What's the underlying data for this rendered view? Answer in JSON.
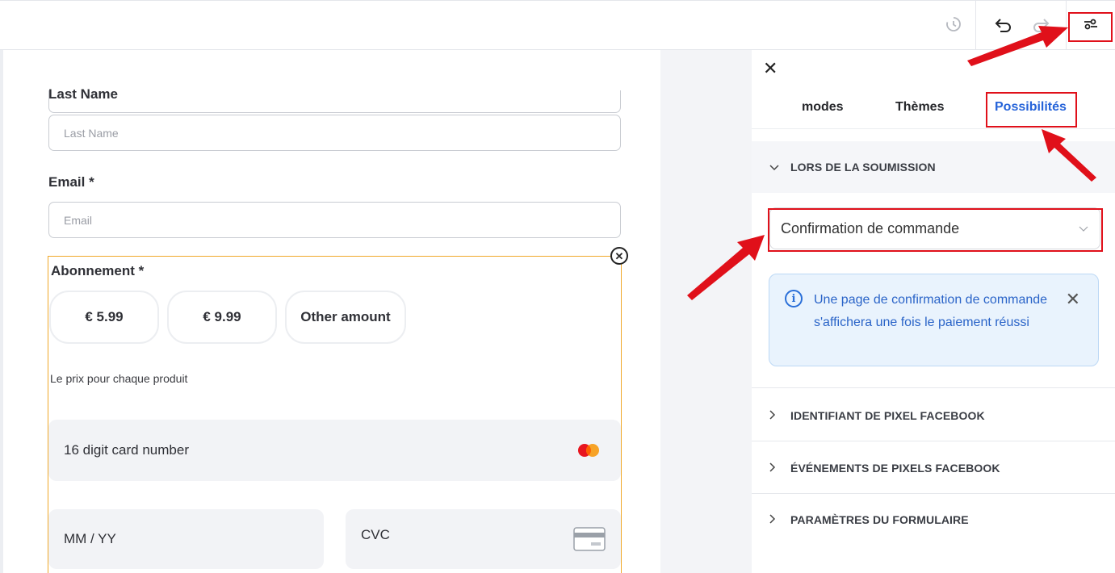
{
  "toolbar": {
    "history_icon": "history-clock-icon",
    "undo_icon": "undo-icon",
    "redo_icon": "redo-icon",
    "settings_icon": "settings-sliders-icon"
  },
  "form": {
    "last_name_label": "Last Name",
    "last_name_placeholder": "Last Name",
    "email_label": "Email  *",
    "email_placeholder": "Email",
    "subscription_label": "Abonnement  *",
    "amounts": [
      "€ 5.99",
      "€ 9.99",
      "Other amount"
    ],
    "price_help": "Le prix pour chaque produit",
    "card_number_placeholder": "16 digit card number",
    "expiry_placeholder": "MM / YY",
    "cvc_placeholder": "CVC"
  },
  "panel": {
    "tabs": [
      "modes",
      "Thèmes",
      "Possibilités"
    ],
    "active_tab": "Possibilités",
    "on_submit_title": "LORS DE LA SOUMISSION",
    "select_value": "Confirmation de commande",
    "info_text": "Une page de confirmation de commande s'affichera une fois le paiement réussi",
    "sections": [
      "IDENTIFIANT DE PIXEL FACEBOOK",
      "ÉVÉNEMENTS DE PIXELS FACEBOOK",
      "PARAMÈTRES DU FORMULAIRE"
    ]
  },
  "colors": {
    "accent_blue": "#2563d9",
    "highlight_red": "#e0101a",
    "block_border_orange": "#f0a92a",
    "info_bg": "#e9f3fd"
  }
}
